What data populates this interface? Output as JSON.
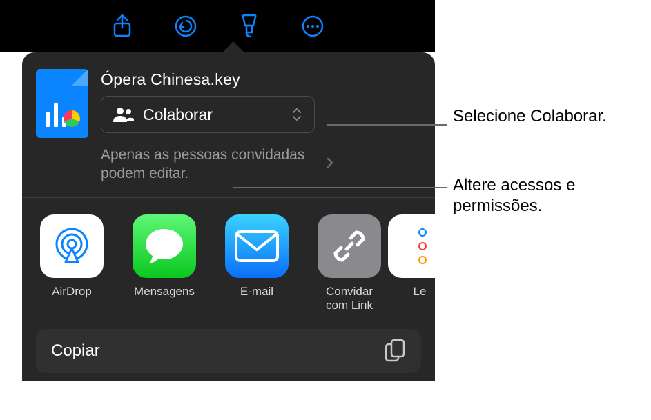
{
  "toolbar": {
    "share_icon": "share-icon",
    "undo_icon": "undo-icon",
    "brush_icon": "brush-icon",
    "more_icon": "more-icon"
  },
  "file": {
    "name": "Ópera Chinesa.key"
  },
  "collaborate": {
    "label": "Colaborar"
  },
  "permissions": {
    "text": "Apenas as pessoas convidadas podem editar."
  },
  "share_apps": {
    "airdrop": "AirDrop",
    "messages": "Mensagens",
    "mail": "E-mail",
    "invite_link": "Convidar com Link",
    "reminders_partial": "Le"
  },
  "actions": {
    "copy": "Copiar"
  },
  "annotations": {
    "a1": "Selecione Colaborar.",
    "a2": "Altere acessos e permissões."
  }
}
